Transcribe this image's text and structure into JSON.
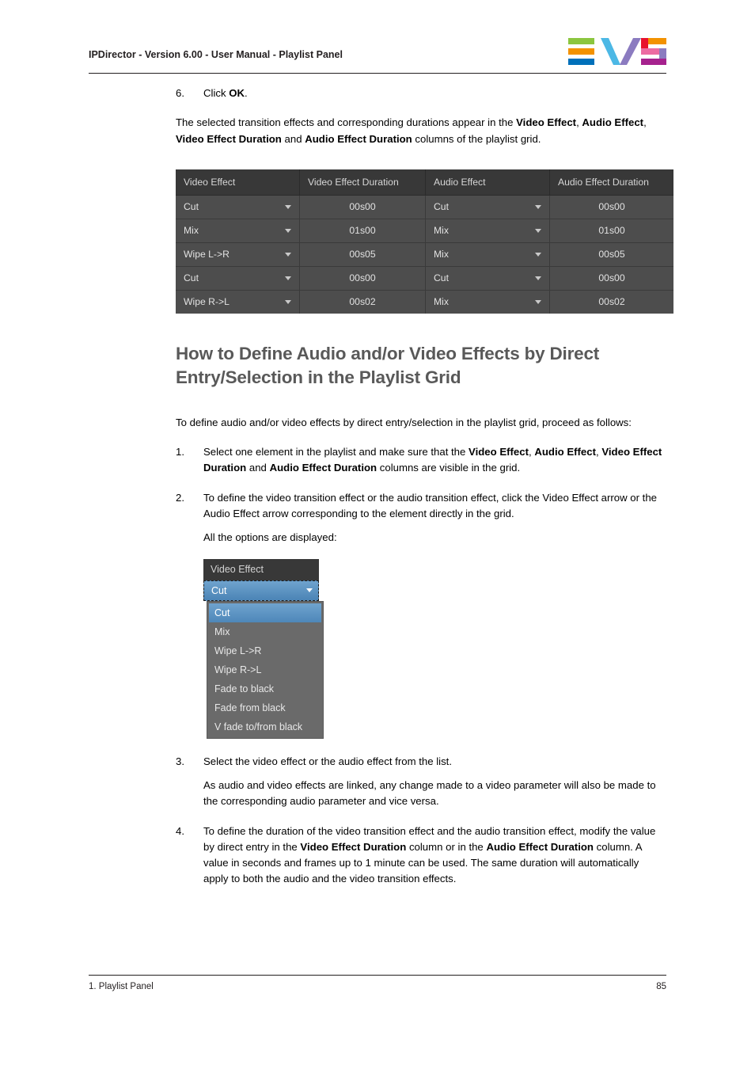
{
  "header": {
    "title": "IPDirector - Version 6.00 - User Manual - Playlist Panel",
    "logo_name": "EVS",
    "logo_colors": {
      "green": "#8cc63f",
      "orange": "#f39200",
      "blue": "#0070ba",
      "cyan": "#4cb8e5",
      "violet": "#8b7bc0",
      "red": "#e8112d",
      "pink": "#ec6ba2",
      "magenta": "#a6228e"
    }
  },
  "body": {
    "step6": {
      "num": "6.",
      "text_before": "Click ",
      "bold": "OK",
      "text_after": "."
    },
    "para_selected": {
      "p1": "The selected transition effects and corresponding durations appear in the ",
      "b1": "Video Effect",
      "p2": ", ",
      "b2": "Audio Effect",
      "p3": ", ",
      "b3": "Video Effect Duration",
      "p4": " and ",
      "b4": "Audio Effect Duration",
      "p5": " columns of the playlist grid."
    },
    "section_heading": "How to Define Audio and/or Video Effects by Direct Entry/Selection in the Playlist Grid",
    "intro": "To define audio and/or video effects by direct entry/selection in the playlist grid, proceed as follows:",
    "step1": {
      "num": "1.",
      "p1": "Select one element in the playlist and make sure that the ",
      "b1": "Video Effect",
      "p2": ", ",
      "b2": "Audio Effect",
      "p3": ", ",
      "b3": "Video Effect Duration",
      "p4": " and ",
      "b4": "Audio Effect Duration",
      "p5": " columns are visible in the grid."
    },
    "step2": {
      "num": "2.",
      "text": "To define the video transition effect or the audio transition effect, click the Video Effect arrow or the Audio Effect arrow corresponding to the element directly in the grid."
    },
    "options_displayed": "All the options are displayed:",
    "step3": {
      "num": "3.",
      "text": "Select the video effect or the audio effect from the list.",
      "note": "As audio and video effects are linked, any change made to a video parameter will also be made to the corresponding audio parameter and vice versa."
    },
    "step4": {
      "num": "4.",
      "p1": "To define the duration of the video transition effect and the audio transition effect, modify the value by direct entry in the ",
      "b1": "Video Effect Duration",
      "p2": " column or in the ",
      "b2": "Audio Effect Duration",
      "p3": " column. A value in seconds and frames up to 1 minute can be used. The same duration will automatically apply to both the audio and the video transition effects."
    }
  },
  "playlist_grid": {
    "columns": [
      "Video Effect",
      "Video Effect Duration",
      "Audio Effect",
      "Audio Effect Duration"
    ],
    "rows": [
      {
        "video_effect": "Cut",
        "video_duration": "00s00",
        "audio_effect": "Cut",
        "audio_duration": "00s00"
      },
      {
        "video_effect": "Mix",
        "video_duration": "01s00",
        "audio_effect": "Mix",
        "audio_duration": "01s00"
      },
      {
        "video_effect": "Wipe L->R",
        "video_duration": "00s05",
        "audio_effect": "Mix",
        "audio_duration": "00s05"
      },
      {
        "video_effect": "Cut",
        "video_duration": "00s00",
        "audio_effect": "Cut",
        "audio_duration": "00s00"
      },
      {
        "video_effect": "Wipe R->L",
        "video_duration": "00s02",
        "audio_effect": "Mix",
        "audio_duration": "00s02"
      }
    ]
  },
  "dropdown": {
    "header_label": "Video Effect",
    "selected_value": "Cut",
    "options": [
      "Cut",
      "Mix",
      "Wipe L->R",
      "Wipe R->L",
      "Fade to black",
      "Fade from black",
      "V fade to/from black"
    ],
    "highlight_color": "#4e87b9"
  },
  "footer": {
    "left": "1. Playlist Panel",
    "page_number": "85"
  }
}
